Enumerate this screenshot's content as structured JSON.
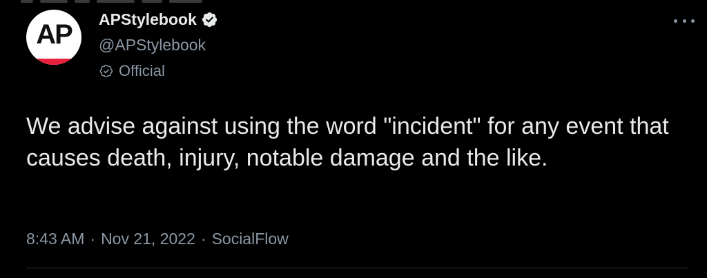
{
  "tweet": {
    "author": {
      "display_name": "APStylebook",
      "handle": "@APStylebook",
      "avatar_text": "AP",
      "verified": true,
      "label": "Official"
    },
    "text": "We advise against using the word \"incident\" for any event that causes death, injury, notable damage and the like.",
    "meta": {
      "time": "8:43 AM",
      "separator": "·",
      "date": "Nov 21, 2022",
      "source": "SocialFlow"
    },
    "icons": {
      "verified": "verified-badge-icon",
      "official": "official-badge-icon",
      "more": "more-options-icon"
    }
  },
  "colors": {
    "background": "#000000",
    "primary_text": "#e7e9ea",
    "secondary_text": "#8b98a5",
    "avatar_accent": "#e8223c",
    "divider": "#2f3336"
  }
}
